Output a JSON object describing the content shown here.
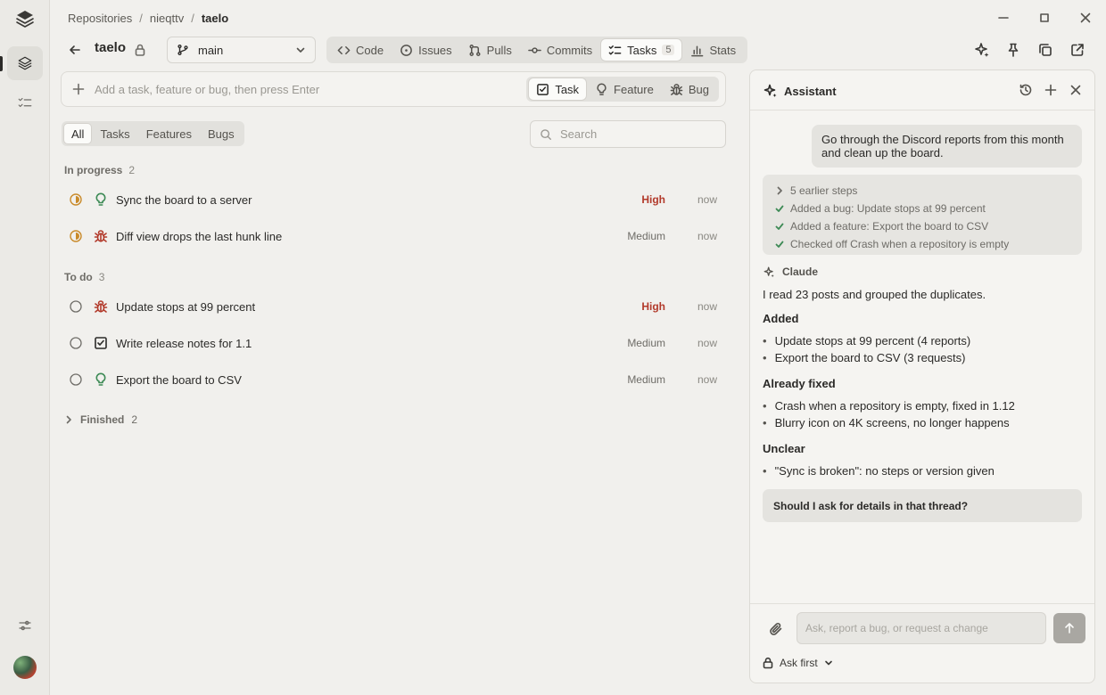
{
  "breadcrumb": {
    "root": "Repositories",
    "sep1": "/",
    "owner": "nieqttv",
    "sep2": "/",
    "repo": "taelo"
  },
  "repo": {
    "title": "taelo",
    "branch": "main"
  },
  "nav_tabs": [
    {
      "label": "Code",
      "icon": "code-icon"
    },
    {
      "label": "Issues",
      "icon": "issue-icon"
    },
    {
      "label": "Pulls",
      "icon": "pull-request-icon"
    },
    {
      "label": "Commits",
      "icon": "commit-icon"
    },
    {
      "label": "Tasks",
      "icon": "tasks-icon",
      "count": "5",
      "active": true
    },
    {
      "label": "Stats",
      "icon": "bar-chart-icon"
    }
  ],
  "add_bar": {
    "placeholder": "Add a task, feature or bug, then press Enter",
    "types": [
      {
        "label": "Task",
        "icon": "checkbox-icon",
        "active": true
      },
      {
        "label": "Feature",
        "icon": "lightbulb-icon"
      },
      {
        "label": "Bug",
        "icon": "bug-icon"
      }
    ]
  },
  "filters": [
    "All",
    "Tasks",
    "Features",
    "Bugs"
  ],
  "search": {
    "placeholder": "Search"
  },
  "sections": {
    "in_progress": {
      "label": "In progress",
      "count": "2",
      "items": [
        {
          "title": "Sync the board to a server",
          "kind": "feature",
          "priority": "High",
          "time": "now"
        },
        {
          "title": "Diff view drops the last hunk line",
          "kind": "bug",
          "priority": "Medium",
          "time": "now"
        }
      ]
    },
    "todo": {
      "label": "To do",
      "count": "3",
      "items": [
        {
          "title": "Update stops at 99 percent",
          "kind": "bug",
          "priority": "High",
          "time": "now"
        },
        {
          "title": "Write release notes for 1.1",
          "kind": "task",
          "priority": "Medium",
          "time": "now"
        },
        {
          "title": "Export the board to CSV",
          "kind": "feature",
          "priority": "Medium",
          "time": "now"
        }
      ]
    },
    "finished": {
      "label": "Finished",
      "count": "2"
    }
  },
  "assistant": {
    "title": "Assistant",
    "user_message": "Go through the Discord reports from this month and clean up the board.",
    "steps_summary": "5 earlier steps",
    "steps": [
      "Added a bug: Update stops at 99 percent",
      "Added a feature: Export the board to CSV",
      "Checked off Crash when a repository is empty"
    ],
    "agent_name": "Claude",
    "intro": "I read 23 posts and grouped the duplicates.",
    "added_heading": "Added",
    "added": [
      "Update stops at 99 percent (4 reports)",
      "Export the board to CSV (3 requests)"
    ],
    "fixed_heading": "Already fixed",
    "fixed": [
      "Crash when a repository is empty, fixed in 1.12",
      "Blurry icon on 4K screens, no longer happens"
    ],
    "unclear_heading": "Unclear",
    "unclear": [
      "\"Sync is broken\": no steps or version given"
    ],
    "suggestion": "Should I ask for details in that thread?",
    "input_placeholder": "Ask, report a bug, or request a change",
    "mode": "Ask first"
  },
  "colors": {
    "accent_high": "#b23a2b",
    "in_progress": "#c98a2a",
    "bug": "#b23a2b",
    "feature": "#3d8a55"
  }
}
